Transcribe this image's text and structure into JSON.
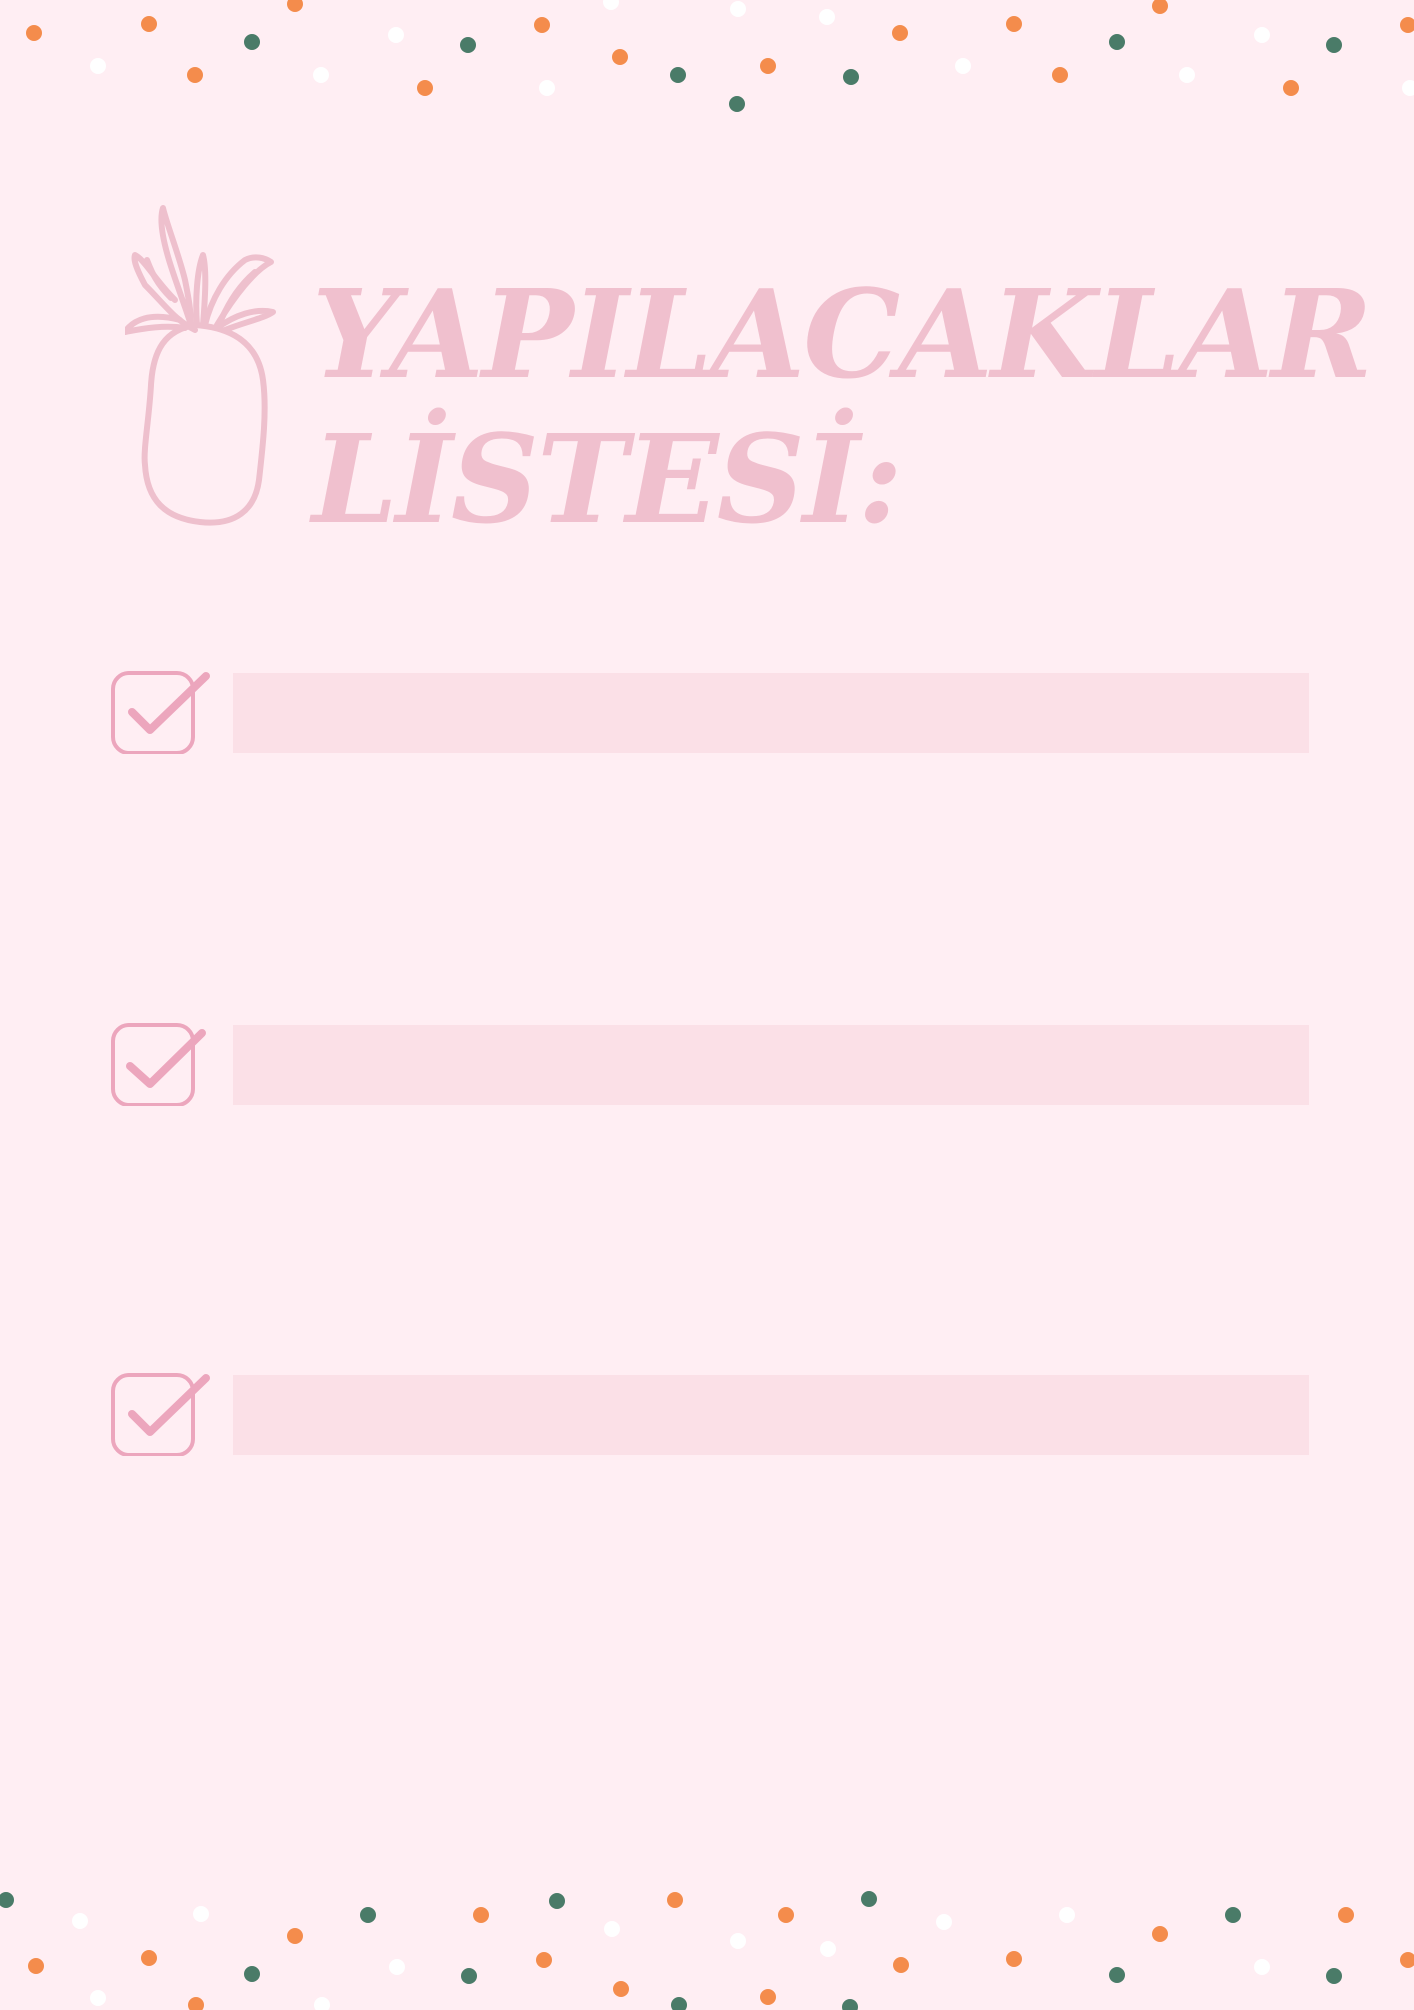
{
  "colors": {
    "background": "#ffeef3",
    "title": "#f0c0ce",
    "checkbox": "#eca6bd",
    "bar": "#fbe0e7",
    "dot_orange": "#f48c4c",
    "dot_green": "#4a7b68",
    "dot_white": "#ffffff"
  },
  "header": {
    "icon": "pineapple-icon",
    "title_line1": "YAPILACAKLAR",
    "title_line2": "LİSTESİ:"
  },
  "todos": [
    {
      "icon": "checkbox-checked-icon",
      "checked": true,
      "text": ""
    },
    {
      "icon": "checkbox-checked-icon",
      "checked": true,
      "text": ""
    },
    {
      "icon": "checkbox-checked-icon",
      "checked": true,
      "text": ""
    }
  ],
  "decorations": {
    "icon": "confetti-dots"
  }
}
